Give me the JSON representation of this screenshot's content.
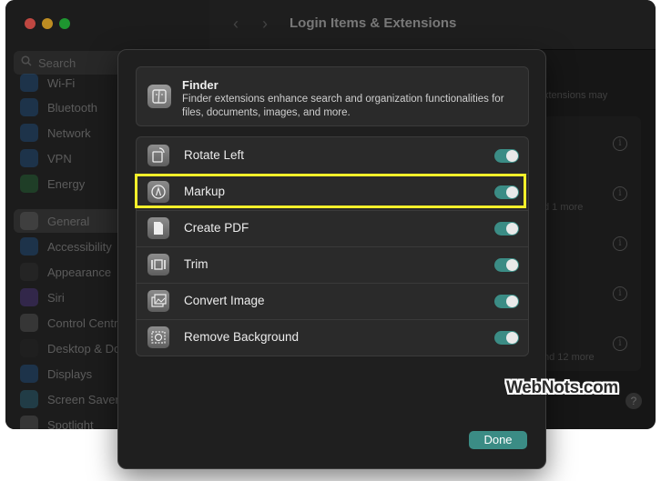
{
  "window": {
    "title": "Login Items & Extensions",
    "nav_back": "‹",
    "nav_forward": "›"
  },
  "sidebar": {
    "search_placeholder": "Search",
    "items": [
      {
        "label": "Wi-Fi",
        "icon": "wifi-icon",
        "color": "#2a7fd6"
      },
      {
        "label": "Bluetooth",
        "icon": "bluetooth-icon",
        "color": "#2a7fd6"
      },
      {
        "label": "Network",
        "icon": "network-icon",
        "color": "#2a7fd6"
      },
      {
        "label": "VPN",
        "icon": "vpn-icon",
        "color": "#2a7fd6"
      },
      {
        "label": "Energy",
        "icon": "energy-icon",
        "color": "#34a853"
      },
      {
        "label": "General",
        "icon": "gear-icon",
        "color": "#8a8a8a"
      },
      {
        "label": "Accessibility",
        "icon": "accessibility-icon",
        "color": "#2a7fd6"
      },
      {
        "label": "Appearance",
        "icon": "appearance-icon",
        "color": "#444444"
      },
      {
        "label": "Siri",
        "icon": "siri-icon",
        "color": "#7b4fd6"
      },
      {
        "label": "Control Centre",
        "icon": "control-centre-icon",
        "color": "#8a8a8a"
      },
      {
        "label": "Desktop & Dock",
        "icon": "dock-icon",
        "color": "#333333"
      },
      {
        "label": "Displays",
        "icon": "displays-icon",
        "color": "#2a7fd6"
      },
      {
        "label": "Screen Saver",
        "icon": "screen-saver-icon",
        "color": "#3aa0c8"
      },
      {
        "label": "Spotlight",
        "icon": "spotlight-icon",
        "color": "#8a8a8a"
      }
    ]
  },
  "background": {
    "description_fragment": "xtensions may",
    "more_1": "d 1 more",
    "more_12": "nd 12 more",
    "info_symbol": "i",
    "help_symbol": "?"
  },
  "sheet": {
    "app_title": "Finder",
    "app_description": "Finder extensions enhance search and organization functionalities for files, documents, images, and more.",
    "extensions": [
      {
        "label": "Rotate Left",
        "icon": "rotate-left-icon",
        "enabled": true
      },
      {
        "label": "Markup",
        "icon": "markup-icon",
        "enabled": true
      },
      {
        "label": "Create PDF",
        "icon": "create-pdf-icon",
        "enabled": true
      },
      {
        "label": "Trim",
        "icon": "trim-icon",
        "enabled": true
      },
      {
        "label": "Convert Image",
        "icon": "convert-image-icon",
        "enabled": true
      },
      {
        "label": "Remove Background",
        "icon": "remove-background-icon",
        "enabled": true
      }
    ],
    "done_label": "Done"
  },
  "colors": {
    "accent": "#3b8c85",
    "highlight": "#f5f02a"
  },
  "watermark": "WebNots.com"
}
